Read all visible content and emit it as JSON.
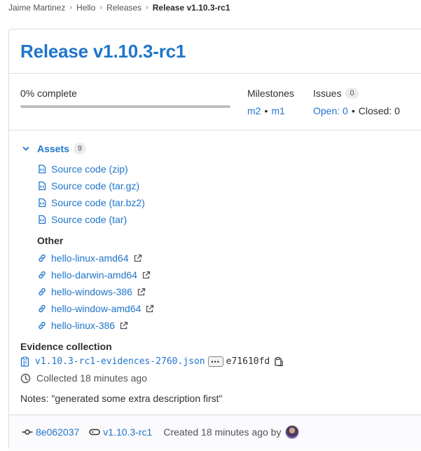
{
  "breadcrumb": {
    "items": [
      "Jaime Martinez",
      "Hello",
      "Releases"
    ],
    "current": "Release v1.10.3-rc1"
  },
  "release": {
    "title": "Release v1.10.3-rc1",
    "progress_label": "0% complete",
    "progress_fraction": 0,
    "milestones_label": "Milestones",
    "milestones": [
      "m2",
      "m1"
    ],
    "issues_label": "Issues",
    "issues_count": "0",
    "issues_open": "Open: 0",
    "issues_closed": "Closed: 0"
  },
  "assets": {
    "label": "Assets",
    "count": "9",
    "sources": [
      "Source code (zip)",
      "Source code (tar.gz)",
      "Source code (tar.bz2)",
      "Source code (tar)"
    ],
    "other_label": "Other",
    "links": [
      "hello-linux-amd64",
      "hello-darwin-amd64",
      "hello-windows-386",
      "hello-window-amd64",
      "hello-linux-386"
    ]
  },
  "evidence": {
    "label": "Evidence collection",
    "file": "v1.10.3-rc1-evidences-2760.json",
    "ellipsis": "•••",
    "hash": "e71610fd",
    "collected": "Collected 18 minutes ago"
  },
  "notes": "Notes: \"generated some extra description first\"",
  "footer": {
    "commit": "8e062037",
    "tag": "v1.10.3-rc1",
    "created": "Created 18 minutes ago by"
  },
  "colors": {
    "link": "#1f75cb",
    "text": "#303030",
    "muted": "#535158",
    "border": "#dcdcde"
  }
}
